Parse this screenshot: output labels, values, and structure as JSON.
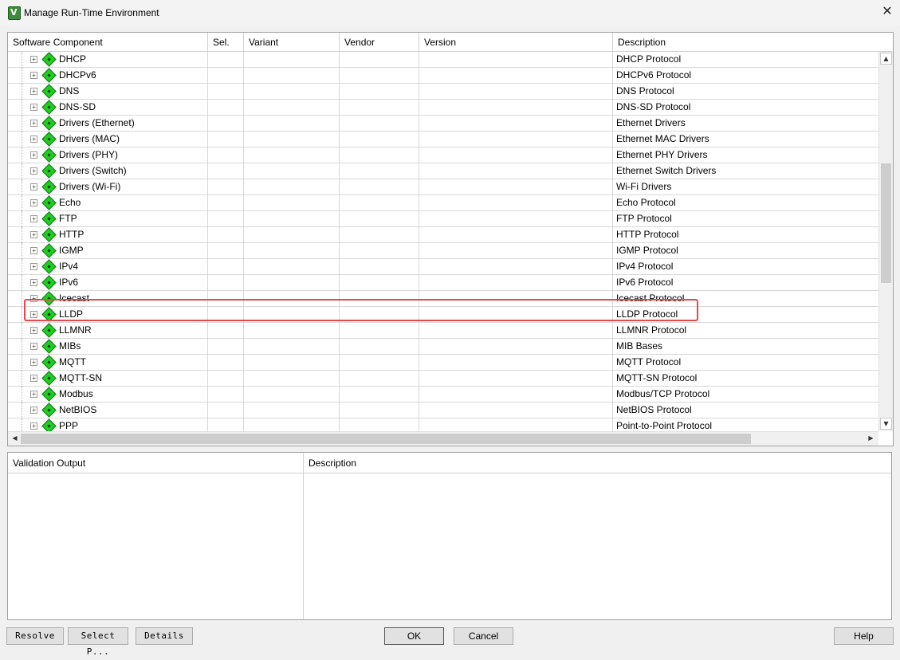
{
  "window": {
    "title": "Manage Run-Time Environment",
    "close_glyph": "✕",
    "app_icon_letter": "V"
  },
  "grid": {
    "columns": [
      "Software Component",
      "Sel.",
      "Variant",
      "Vendor",
      "Version",
      "Description"
    ],
    "rows": [
      {
        "component": "DHCP",
        "description": "DHCP Protocol"
      },
      {
        "component": "DHCPv6",
        "description": "DHCPv6 Protocol"
      },
      {
        "component": "DNS",
        "description": "DNS Protocol"
      },
      {
        "component": "DNS-SD",
        "description": "DNS-SD Protocol"
      },
      {
        "component": "Drivers (Ethernet)",
        "description": "Ethernet Drivers"
      },
      {
        "component": "Drivers (MAC)",
        "description": "Ethernet MAC Drivers"
      },
      {
        "component": "Drivers (PHY)",
        "description": "Ethernet PHY Drivers"
      },
      {
        "component": "Drivers (Switch)",
        "description": "Ethernet Switch Drivers"
      },
      {
        "component": "Drivers (Wi-Fi)",
        "description": "Wi-Fi Drivers"
      },
      {
        "component": "Echo",
        "description": "Echo Protocol"
      },
      {
        "component": "FTP",
        "description": "FTP Protocol"
      },
      {
        "component": "HTTP",
        "description": "HTTP Protocol"
      },
      {
        "component": "IGMP",
        "description": "IGMP Protocol"
      },
      {
        "component": "IPv4",
        "description": "IPv4 Protocol"
      },
      {
        "component": "IPv6",
        "description": "IPv6 Protocol"
      },
      {
        "component": "Icecast",
        "description": "Icecast Protocol"
      },
      {
        "component": "LLDP",
        "description": "LLDP Protocol"
      },
      {
        "component": "LLMNR",
        "description": "LLMNR Protocol"
      },
      {
        "component": "MIBs",
        "description": "MIB Bases"
      },
      {
        "component": "MQTT",
        "description": "MQTT Protocol"
      },
      {
        "component": "MQTT-SN",
        "description": "MQTT-SN Protocol"
      },
      {
        "component": "Modbus",
        "description": "Modbus/TCP Protocol"
      },
      {
        "component": "NetBIOS",
        "description": "NetBIOS Protocol"
      },
      {
        "component": "PPP",
        "description": "Point-to-Point Protocol"
      }
    ],
    "highlighted_component": "LLDP"
  },
  "validation": {
    "columns": [
      "Validation Output",
      "Description"
    ]
  },
  "buttons": {
    "resolve": "Resolve",
    "select_packs": "Select P...",
    "details": "Details",
    "ok": "OK",
    "cancel": "Cancel",
    "help": "Help"
  },
  "colors": {
    "component_icon": "#22cc22",
    "highlight": "#e8484a"
  }
}
